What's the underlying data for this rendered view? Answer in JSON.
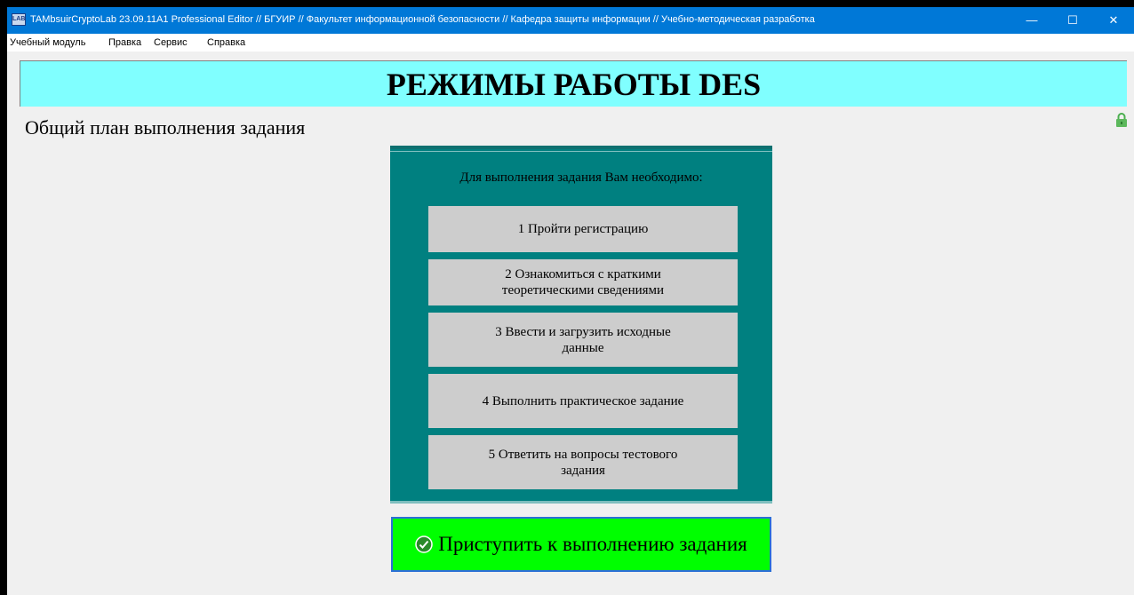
{
  "window": {
    "title": "TAMbsuirCryptoLab 23.09.11A1 Professional Editor // БГУИР // Факультет информационной безопасности // Кафедра защиты информации // Учебно-методическая разработка",
    "icon": "app-icon",
    "controls": {
      "minimize": "—",
      "maximize": "☐",
      "close": "✕"
    }
  },
  "menu": {
    "items": [
      "Учебный модуль",
      "Правка",
      "Сервис",
      "Справка"
    ]
  },
  "banner": {
    "title": "РЕЖИМЫ РАБОТЫ DES",
    "color": "#80ffff"
  },
  "subtitle": "Общий план выполнения задания",
  "panel": {
    "heading": "Для выполнения задания Вам необходимо:",
    "color": "#008080",
    "steps": [
      "1 Пройти регистрацию",
      "2 Ознакомиться с краткими теоретическими сведениями",
      "3 Ввести и загрузить исходные данные",
      "4 Выполнить практическое задание",
      "5 Ответить на вопросы тестового задания"
    ]
  },
  "start_button": {
    "label": "Приступить к выполнению задания",
    "icon": "check-circle-icon",
    "color": "#00ff00"
  }
}
